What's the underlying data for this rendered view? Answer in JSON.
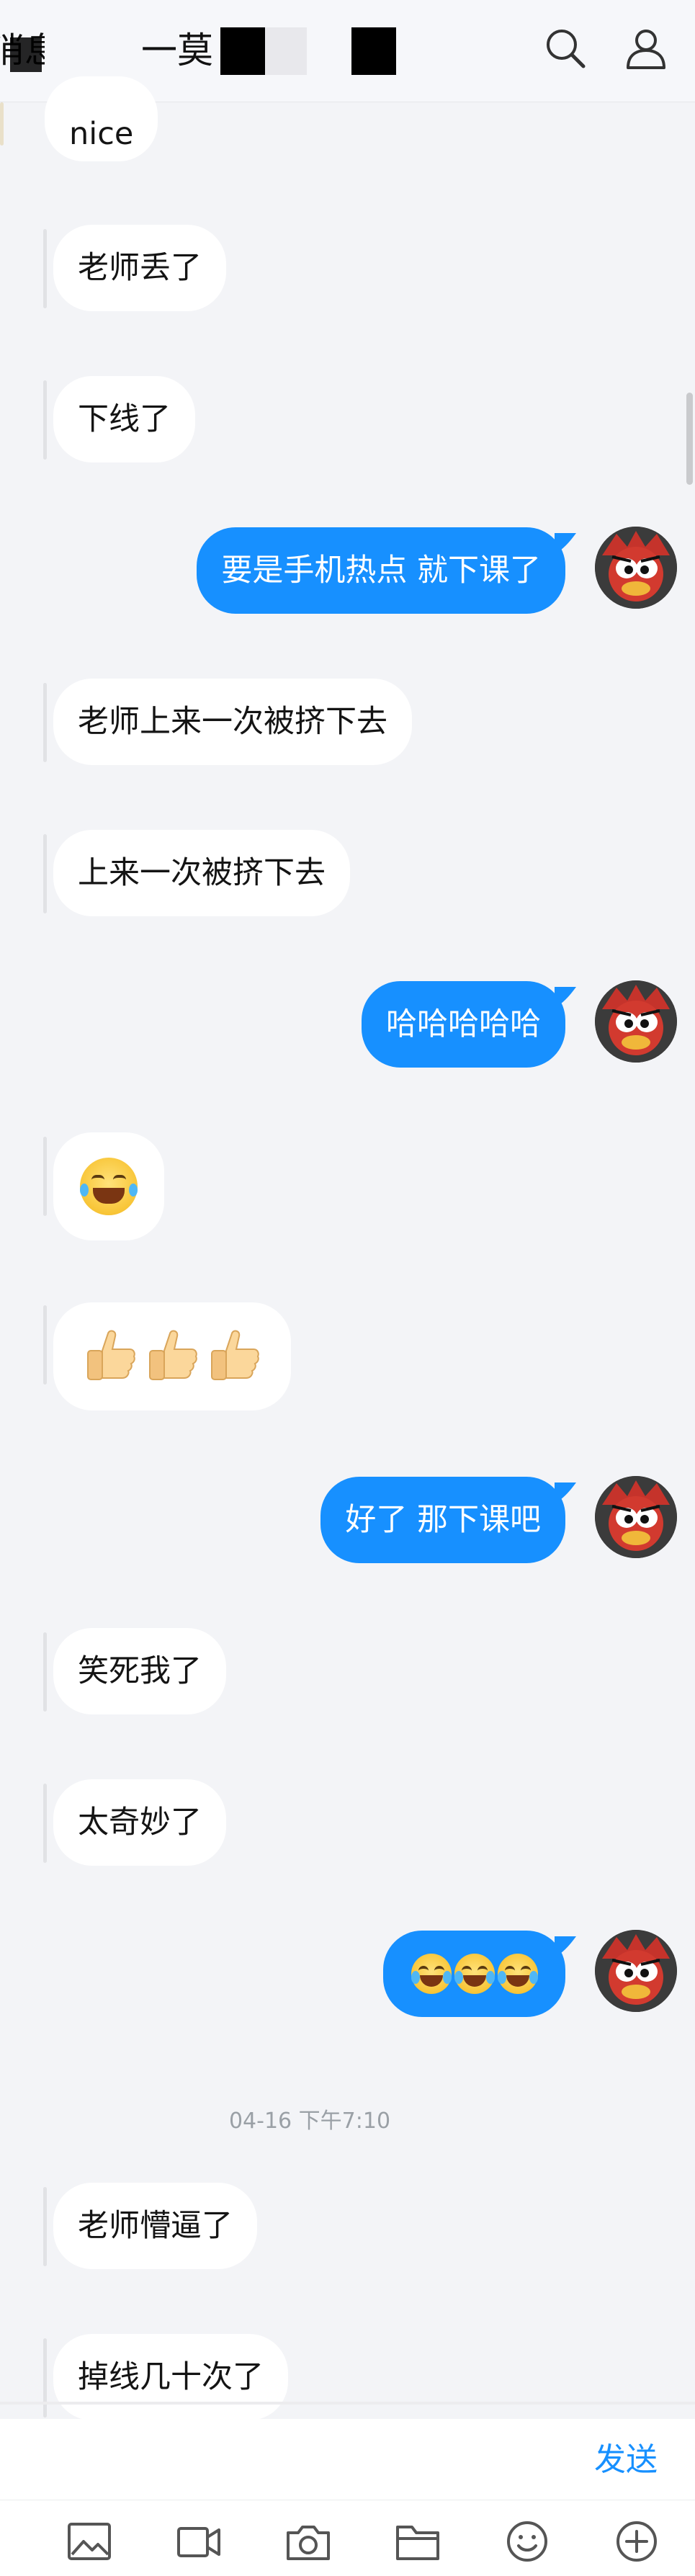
{
  "header": {
    "back_label": "消息",
    "title": "一莫",
    "search_icon": "search-icon",
    "profile_icon": "profile-icon"
  },
  "messages": [
    {
      "side": "in",
      "text": "nice"
    },
    {
      "side": "in",
      "text": "老师丢了"
    },
    {
      "side": "in",
      "text": "下线了"
    },
    {
      "side": "out",
      "text": "要是手机热点 就下课了"
    },
    {
      "side": "in",
      "text": "老师上来一次被挤下去"
    },
    {
      "side": "in",
      "text": "上来一次被挤下去"
    },
    {
      "side": "out",
      "text": "哈哈哈哈哈"
    },
    {
      "side": "in",
      "emoji": "tears-of-joy"
    },
    {
      "side": "in",
      "emoji": "thumbs-up x3"
    },
    {
      "side": "out",
      "text": "好了 那下课吧"
    },
    {
      "side": "in",
      "text": "笑死我了"
    },
    {
      "side": "in",
      "text": "太奇妙了"
    },
    {
      "side": "out",
      "emoji": "tears-of-joy x3"
    },
    {
      "side": "in",
      "text": "老师懵逼了"
    },
    {
      "side": "in",
      "text": "掉线几十次了"
    }
  ],
  "timestamp": "04-16 下午7:10",
  "input": {
    "send_label": "发送"
  },
  "toolbar": [
    "image-icon",
    "video-icon",
    "camera-icon",
    "folder-icon",
    "emoji-icon",
    "plus-icon"
  ],
  "colors": {
    "outgoing_bubble": "#1790ff",
    "incoming_bubble": "#ffffff",
    "background": "#f3f4f7",
    "accent": "#1790ff"
  }
}
